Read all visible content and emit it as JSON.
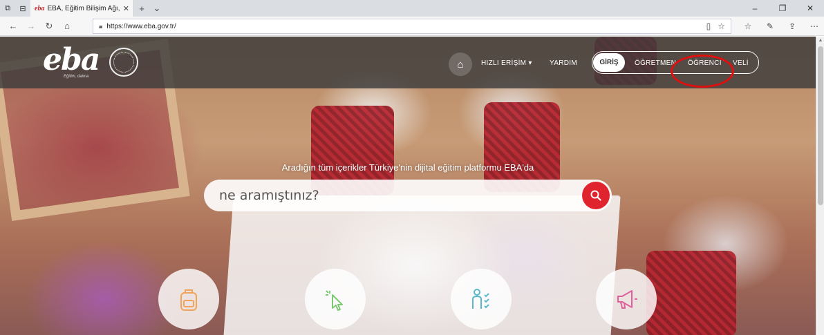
{
  "browser": {
    "tab": {
      "favicon_text": "eba",
      "title": "EBA, Eğitim Bilişim Ağı,",
      "close": "✕"
    },
    "new_tab": "+",
    "tab_list": "⌄",
    "window_controls": {
      "minimize": "–",
      "restore": "❐",
      "close": "✕"
    },
    "address": {
      "url": "https://www.eba.gov.tr/"
    },
    "icons": [
      "back-icon",
      "forward-icon",
      "refresh-icon",
      "home-icon",
      "lock-icon",
      "reading-view-icon",
      "favorite-star-icon",
      "favorites-list-icon",
      "pen-icon",
      "share-icon",
      "more-icon"
    ]
  },
  "site": {
    "logo_text": "eba",
    "logo_subtitle": "Eğitim, daima",
    "nav": {
      "quick_access": "HIZLI ERİŞİM",
      "help": "YARDIM",
      "login": "GİRİŞ",
      "teacher": "ÖĞRETMEN",
      "student": "ÖĞRENCİ",
      "parent": "VELİ"
    },
    "tagline": "Aradığın tüm içerikler Türkiye'nin dijital eğitim platformu EBA'da",
    "search": {
      "placeholder": "ne aramıştınız?"
    },
    "feature_buttons": [
      "backpack-icon",
      "cursor-click-icon",
      "person-checklist-icon",
      "megaphone-icon"
    ],
    "colors": {
      "accent_red": "#e0242e",
      "annotation_red": "#e01010",
      "icon_orange": "#f2a35a",
      "icon_green": "#7ec874",
      "icon_teal": "#5ab9c8",
      "icon_pink": "#e0609c"
    }
  }
}
